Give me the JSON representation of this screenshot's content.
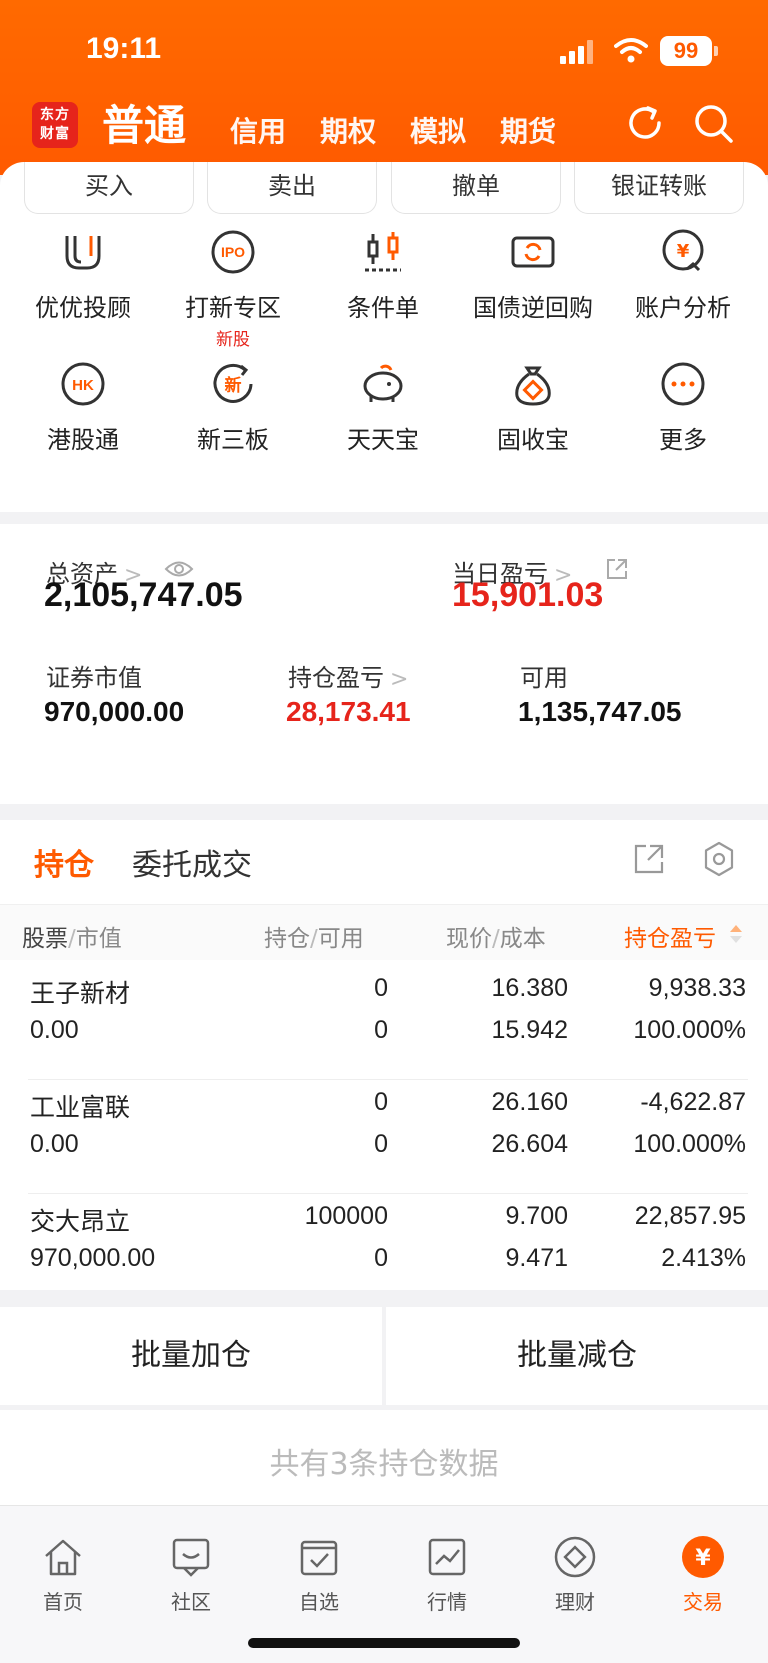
{
  "status_bar": {
    "time": "19:11",
    "battery": "99"
  },
  "app": {
    "logo_line1": "东方",
    "logo_line2": "财富"
  },
  "nav": {
    "tabs": [
      "普通",
      "信用",
      "期权",
      "模拟",
      "期货"
    ]
  },
  "quick_actions": [
    "买入",
    "卖出",
    "撤单",
    "银证转账"
  ],
  "services": [
    {
      "label": "优优投顾",
      "icon": "uu-icon"
    },
    {
      "label": "打新专区",
      "icon": "ipo-icon",
      "badge": "新股"
    },
    {
      "label": "条件单",
      "icon": "candlestick-icon"
    },
    {
      "label": "国债逆回购",
      "icon": "bond-icon"
    },
    {
      "label": "账户分析",
      "icon": "yuan-chart-icon"
    },
    {
      "label": "港股通",
      "icon": "hk-icon"
    },
    {
      "label": "新三板",
      "icon": "new-icon"
    },
    {
      "label": "天天宝",
      "icon": "piggy-icon"
    },
    {
      "label": "固收宝",
      "icon": "bag-icon"
    },
    {
      "label": "更多",
      "icon": "more-icon"
    }
  ],
  "assets": {
    "total_label": "总资产",
    "total_value": "2,105,747.05",
    "daily_pnl_label": "当日盈亏",
    "daily_pnl_value": "15,901.03",
    "market_value_label": "证券市值",
    "market_value": "970,000.00",
    "position_pnl_label": "持仓盈亏",
    "position_pnl_value": "28,173.41",
    "available_label": "可用",
    "available_value": "1,135,747.05"
  },
  "holdings": {
    "tabs": [
      "持仓",
      "委托成交"
    ],
    "headers": {
      "col1a": "股票",
      "col1b": "市值",
      "col2a": "持仓",
      "col2b": "可用",
      "col3a": "现价",
      "col3b": "成本",
      "col4": "持仓盈亏"
    },
    "rows": [
      {
        "name": "王子新材",
        "market_value": "0.00",
        "position": "0",
        "available": "0",
        "price": "16.380",
        "cost": "15.942",
        "pnl": "9,938.33",
        "pnl_pct": "100.000%",
        "tone": "red"
      },
      {
        "name": "工业富联",
        "market_value": "0.00",
        "position": "0",
        "available": "0",
        "price": "26.160",
        "cost": "26.604",
        "pnl": "-4,622.87",
        "pnl_pct": "100.000%",
        "tone": "green"
      },
      {
        "name": "交大昂立",
        "market_value": "970,000.00",
        "position": "100000",
        "available": "0",
        "price": "9.700",
        "cost": "9.471",
        "pnl": "22,857.95",
        "pnl_pct": "2.413%",
        "tone": "red"
      }
    ],
    "batch_add": "批量加仓",
    "batch_reduce": "批量减仓",
    "summary": "共有3条持仓数据"
  },
  "tabbar": [
    {
      "label": "首页",
      "icon": "home-icon"
    },
    {
      "label": "社区",
      "icon": "community-icon"
    },
    {
      "label": "自选",
      "icon": "watchlist-icon"
    },
    {
      "label": "行情",
      "icon": "market-icon"
    },
    {
      "label": "理财",
      "icon": "wealth-icon"
    },
    {
      "label": "交易",
      "icon": "trade-icon"
    }
  ],
  "colors": {
    "brand": "#ff5a00",
    "up": "#e6241b",
    "down": "#1aa21a"
  }
}
